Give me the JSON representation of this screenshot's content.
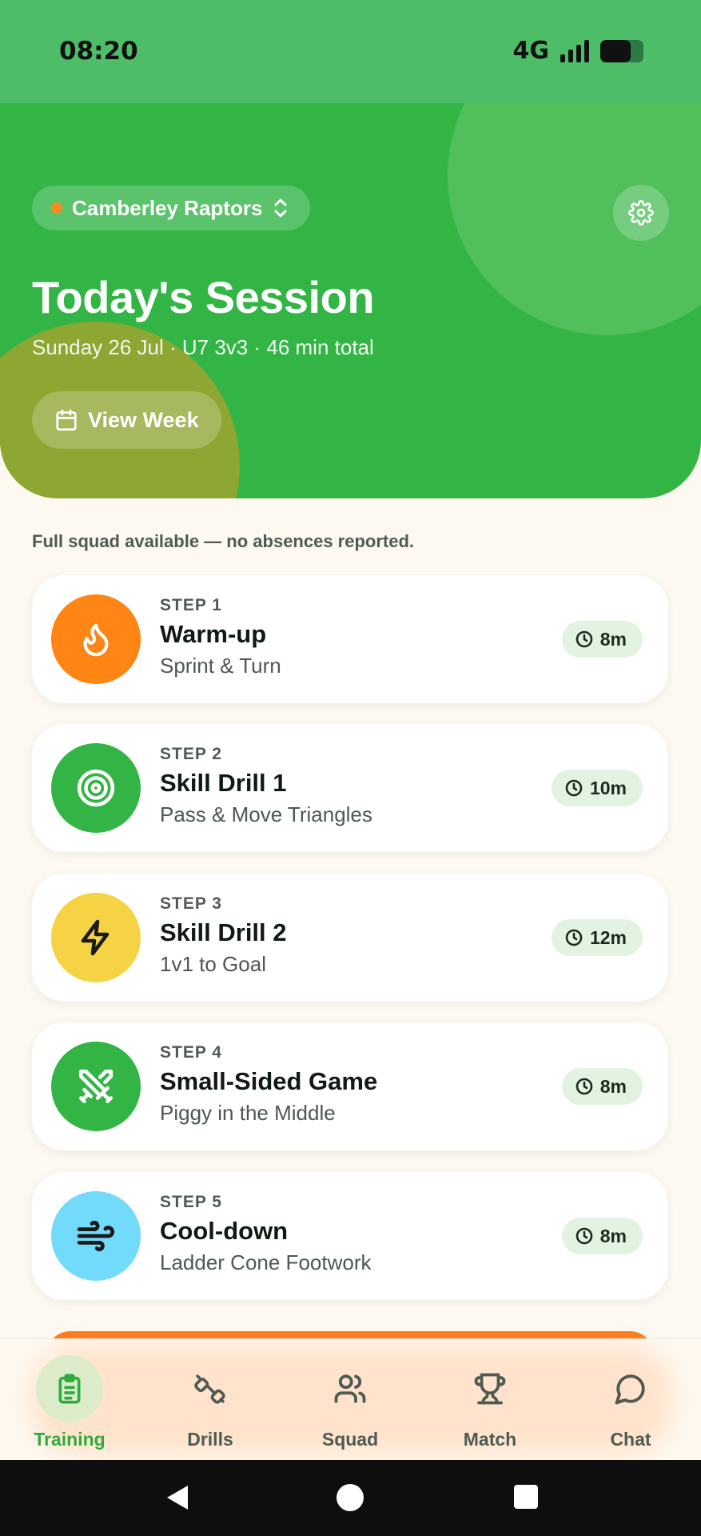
{
  "status_bar": {
    "time": "08:20",
    "network": "4G",
    "battery_level": 0.7
  },
  "hero": {
    "team_name": "Camberley Raptors",
    "title": "Today's Session",
    "subtitle": "Sunday 26 Jul · U7 3v3 · 46 min total",
    "view_week_label": "View Week"
  },
  "notice": "Full squad available — no absences reported.",
  "steps": [
    {
      "step": "STEP 1",
      "title": "Warm-up",
      "subtitle": "Sprint & Turn",
      "duration": "8m",
      "icon": "flame-icon",
      "color": "#ff8514"
    },
    {
      "step": "STEP 2",
      "title": "Skill Drill 1",
      "subtitle": "Pass & Move Triangles",
      "duration": "10m",
      "icon": "target-icon",
      "color": "#33b546"
    },
    {
      "step": "STEP 3",
      "title": "Skill Drill 2",
      "subtitle": "1v1 to Goal",
      "duration": "12m",
      "icon": "lightning-icon",
      "color": "#f6d344"
    },
    {
      "step": "STEP 4",
      "title": "Small-Sided Game",
      "subtitle": "Piggy in the Middle",
      "duration": "8m",
      "icon": "swords-icon",
      "color": "#33b546"
    },
    {
      "step": "STEP 5",
      "title": "Cool-down",
      "subtitle": "Ladder Cone Footwork",
      "duration": "8m",
      "icon": "wind-icon",
      "color": "#72dbfb"
    }
  ],
  "nav": {
    "items": [
      {
        "label": "Training",
        "icon": "clipboard-icon",
        "active": true
      },
      {
        "label": "Drills",
        "icon": "dumbbell-icon",
        "active": false
      },
      {
        "label": "Squad",
        "icon": "users-icon",
        "active": false
      },
      {
        "label": "Match",
        "icon": "trophy-icon",
        "active": false
      },
      {
        "label": "Chat",
        "icon": "chat-icon",
        "active": false
      }
    ]
  },
  "colors": {
    "hero_green": "#33b546",
    "accent_orange": "#ff8514",
    "active_nav": "#2eac3f"
  }
}
